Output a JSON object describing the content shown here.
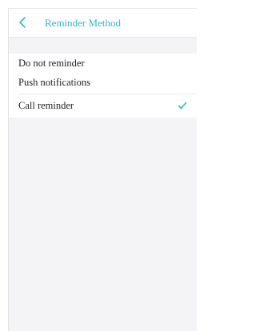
{
  "header": {
    "title": "Reminder Method",
    "back_icon": "chevron-left-icon"
  },
  "options": [
    {
      "label": "Do not reminder",
      "selected": false
    },
    {
      "label": "Push notifications",
      "selected": false
    },
    {
      "label": "Call reminder",
      "selected": true
    }
  ],
  "colors": {
    "accent": "#35b6d4",
    "background": "#f4f4f6",
    "text": "#1f1f1f"
  }
}
